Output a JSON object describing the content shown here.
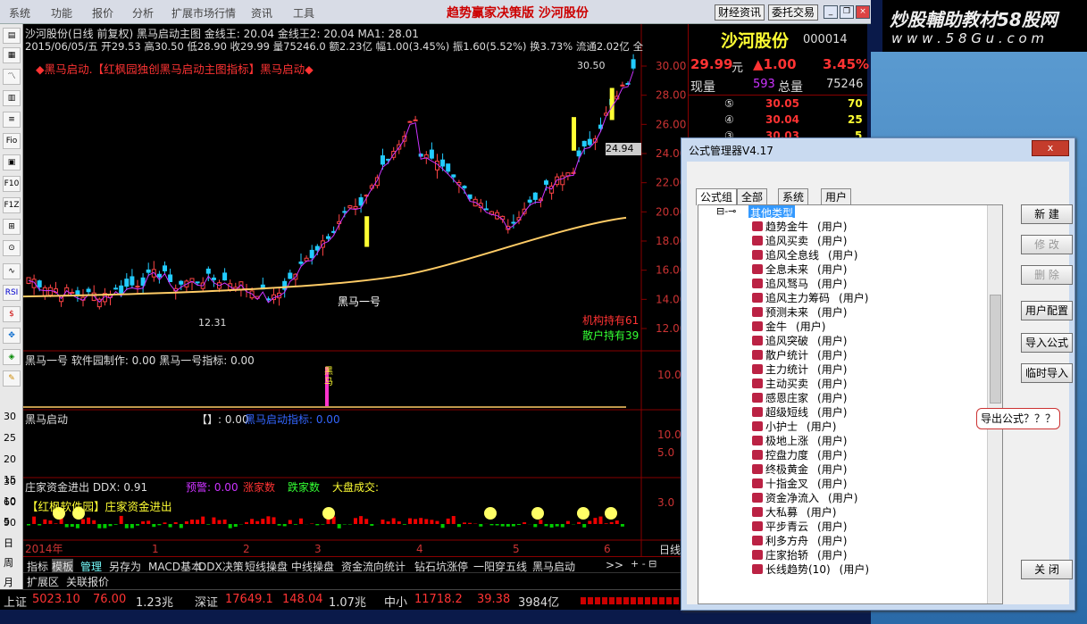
{
  "menu": {
    "items": [
      "系统",
      "功能",
      "报价",
      "分析",
      "扩展市场行情",
      "资讯",
      "工具"
    ],
    "app_title": "趋势赢家决策版  沙河股份",
    "btn_news": "财经资讯",
    "btn_trade": "委托交易"
  },
  "watermark": {
    "line1": "炒股輔助教材58股网",
    "line2": "w w w . 5 8 G u . c o m"
  },
  "chart": {
    "header1": "沙河股份(日线 前复权) 黑马启动主图  金线王: 20.04 金线王2: 20.04        MA1: 28.01",
    "header2": "2015/06/05/五 开29.53 高30.50 低28.90 收29.99 量75246.0 额2.23亿 幅1.00(3.45%) 振1.60(5.52%) 换3.73% 流通2.02亿 全",
    "banner": "◆黑马启动.【红枫园独创黑马启动主图指标】黑马启动◆",
    "high_label": "30.50",
    "low_label": "12.31",
    "signal_label": "黑马一号",
    "price_tag": "24.94",
    "inst_hold": "机构持有61",
    "retail_hold": "散户持有39",
    "y_ticks": [
      "30.00",
      "28.00",
      "26.00",
      "24.00",
      "22.00",
      "20.00",
      "18.00",
      "16.00",
      "14.00",
      "12.00"
    ],
    "sub1_title": "黑马一号  软件园制作: 0.00  黑马一号指标: 0.00",
    "sub1_tick": "10.0",
    "sub1_vert": "黑马",
    "sub2_title": "黑马启动",
    "sub2_extra": "【】: 0.00",
    "sub2_extra2": "黑马启动指标: 0.00",
    "sub2_ticks": [
      "10.0",
      "10.0",
      "5.0"
    ],
    "sub3_title": "庄家资金进出  DDX: 0.91",
    "sub3_warn": "预警: 0.00",
    "sub3_up": "涨家数",
    "sub3_down": "跌家数",
    "sub3_vol": "大盘成交:",
    "sub3_banner": "【红枫软件园】庄家资金进出",
    "sub3_tick": "3.0",
    "left_ticks": [
      "30",
      "25",
      "20",
      "15",
      "10",
      "5",
      "30",
      "60",
      "90",
      "日",
      "周",
      "月"
    ],
    "x_labels": [
      "2014年",
      "1",
      "2",
      "3",
      "4",
      "5",
      "6"
    ],
    "period": "日线",
    "corner": "+ - ⊟"
  },
  "stock": {
    "name": "沙河股份",
    "code": "000014",
    "price": "29.99",
    "unit": "元",
    "change": "▲1.00",
    "pct": "3.45%",
    "vol_label": "现量",
    "vol": "593",
    "total_label": "总量",
    "total": "75246",
    "asks": [
      {
        "n": "⑤",
        "p": "30.05",
        "v": "70"
      },
      {
        "n": "④",
        "p": "30.04",
        "v": "25"
      },
      {
        "n": "③",
        "p": "30.03",
        "v": "5"
      }
    ]
  },
  "bottom_tabs": [
    "指标",
    "模板",
    "管理",
    "另存为",
    "MACD基本",
    "DDX决策",
    "短线操盘",
    "中线操盘",
    "资金流向统计",
    "钻石坑涨停",
    "一阳穿五线",
    "黑马启动",
    ">>"
  ],
  "bottom_tabs2": [
    "扩展区",
    "关联报价"
  ],
  "status": {
    "sh_label": "上证",
    "sh_val": "5023.10",
    "sh_chg": "76.00",
    "sh_amt": "1.23兆",
    "sz_label": "深证",
    "sz_val": "17649.1",
    "sz_chg": "148.04",
    "sz_amt": "1.07兆",
    "zx_label": "中小",
    "zx_val": "11718.2",
    "zx_chg": "39.38",
    "zx_amt": "3984亿"
  },
  "dialog": {
    "title": "公式管理器V4.17",
    "close": "x",
    "tabs": [
      "公式组",
      "全部",
      "系统",
      "用户"
    ],
    "tree_root": "其他类型",
    "items": [
      {
        "name": "趋势金牛",
        "tag": "(用户)"
      },
      {
        "name": "追风买卖",
        "tag": "(用户)"
      },
      {
        "name": "追风全息线",
        "tag": "(用户)"
      },
      {
        "name": "全息未来",
        "tag": "(用户)"
      },
      {
        "name": "追风驽马",
        "tag": "(用户)"
      },
      {
        "name": "追风主力筹码",
        "tag": "(用户)"
      },
      {
        "name": "预测未来",
        "tag": "(用户)"
      },
      {
        "name": "金牛",
        "tag": "(用户)"
      },
      {
        "name": "追风突破",
        "tag": "(用户)"
      },
      {
        "name": "散户统计",
        "tag": "(用户)"
      },
      {
        "name": "主力统计",
        "tag": "(用户)"
      },
      {
        "name": "主动买卖",
        "tag": "(用户)"
      },
      {
        "name": "感恩庄家",
        "tag": "(用户)"
      },
      {
        "name": "超级短线",
        "tag": "(用户)"
      },
      {
        "name": "小护士",
        "tag": "(用户)"
      },
      {
        "name": "极地上涨",
        "tag": "(用户)"
      },
      {
        "name": "控盘力度",
        "tag": "(用户)"
      },
      {
        "name": "终极黄金",
        "tag": "(用户)"
      },
      {
        "name": "十指金叉",
        "tag": "(用户)"
      },
      {
        "name": "资金净流入",
        "tag": "(用户)"
      },
      {
        "name": "大私募",
        "tag": "(用户)"
      },
      {
        "name": "平步青云",
        "tag": "(用户)"
      },
      {
        "name": "利多方舟",
        "tag": "(用户)"
      },
      {
        "name": "庄家抬轿",
        "tag": "(用户)"
      },
      {
        "name": "长线趋势(10)",
        "tag": "(用户)"
      }
    ],
    "buttons": {
      "new": "新  建",
      "edit": "修  改",
      "delete": "删  除",
      "user_cfg": "用户配置",
      "import": "导入公式",
      "temp_import": "临时导入",
      "close": "关  闭"
    },
    "callout": "导出公式？？？"
  },
  "left_toolbar": [
    "Fio",
    "F10",
    "F1Z",
    "RSI",
    "$",
    "F5"
  ]
}
